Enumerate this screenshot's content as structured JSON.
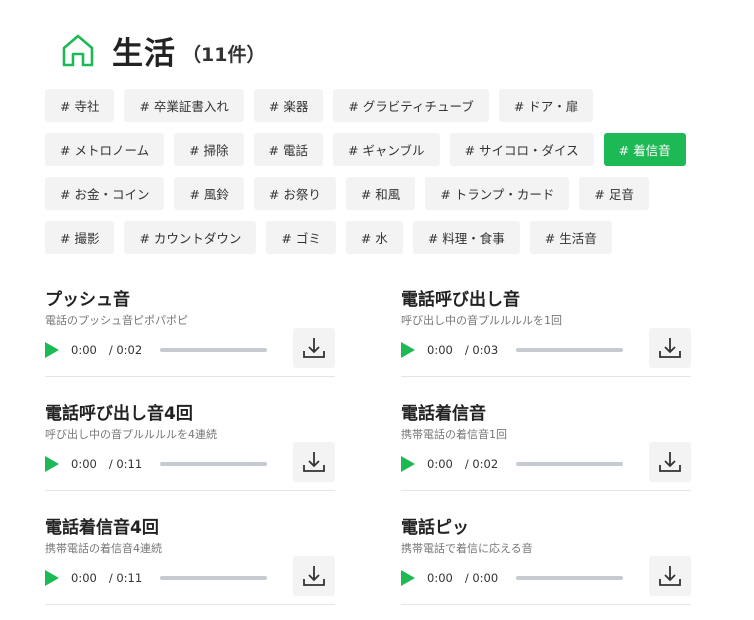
{
  "header": {
    "title": "生活",
    "count": "（11件）",
    "icon": "home-icon",
    "accent": "#1db954"
  },
  "tag_rows": [
    [
      {
        "label": "# 寺社"
      },
      {
        "label": "# 卒業証書入れ"
      },
      {
        "label": "# 楽器"
      },
      {
        "label": "# グラビティチューブ"
      },
      {
        "label": "# ドア・扉"
      }
    ],
    [
      {
        "label": "# メトロノーム"
      },
      {
        "label": "# 掃除"
      },
      {
        "label": "# 電話"
      },
      {
        "label": "# ギャンブル"
      },
      {
        "label": "# サイコロ・ダイス"
      },
      {
        "label": "# 着信音",
        "active": true
      }
    ],
    [
      {
        "label": "# お金・コイン"
      },
      {
        "label": "# 風鈴"
      },
      {
        "label": "# お祭り"
      },
      {
        "label": "# 和風"
      },
      {
        "label": "# トランプ・カード"
      },
      {
        "label": "# 足音"
      }
    ],
    [
      {
        "label": "# 撮影"
      },
      {
        "label": "# カウントダウン"
      },
      {
        "label": "# ゴミ"
      },
      {
        "label": "# 水"
      },
      {
        "label": "# 料理・食事"
      },
      {
        "label": "# 生活音"
      }
    ]
  ],
  "sounds": [
    {
      "title": "プッシュ音",
      "desc": "電話のプッシュ音ピポパポピ",
      "current": "0:00",
      "duration": "/ 0:02",
      "progress": 0
    },
    {
      "title": "電話呼び出し音",
      "desc": "呼び出し中の音プルルルルを1回",
      "current": "0:00",
      "duration": "/ 0:03",
      "progress": 0
    },
    {
      "title": "電話呼び出し音4回",
      "desc": "呼び出し中の音プルルルルを4連続",
      "current": "0:00",
      "duration": "/ 0:11",
      "progress": 0
    },
    {
      "title": "電話着信音",
      "desc": "携帯電話の着信音1回",
      "current": "0:00",
      "duration": "/ 0:02",
      "progress": 0
    },
    {
      "title": "電話着信音4回",
      "desc": "携帯電話の着信音4連続",
      "current": "0:00",
      "duration": "/ 0:11",
      "progress": 0
    },
    {
      "title": "電話ピッ",
      "desc": "携帯電話で着信に応える音",
      "current": "0:00",
      "duration": "/ 0:00",
      "progress": 0
    }
  ]
}
